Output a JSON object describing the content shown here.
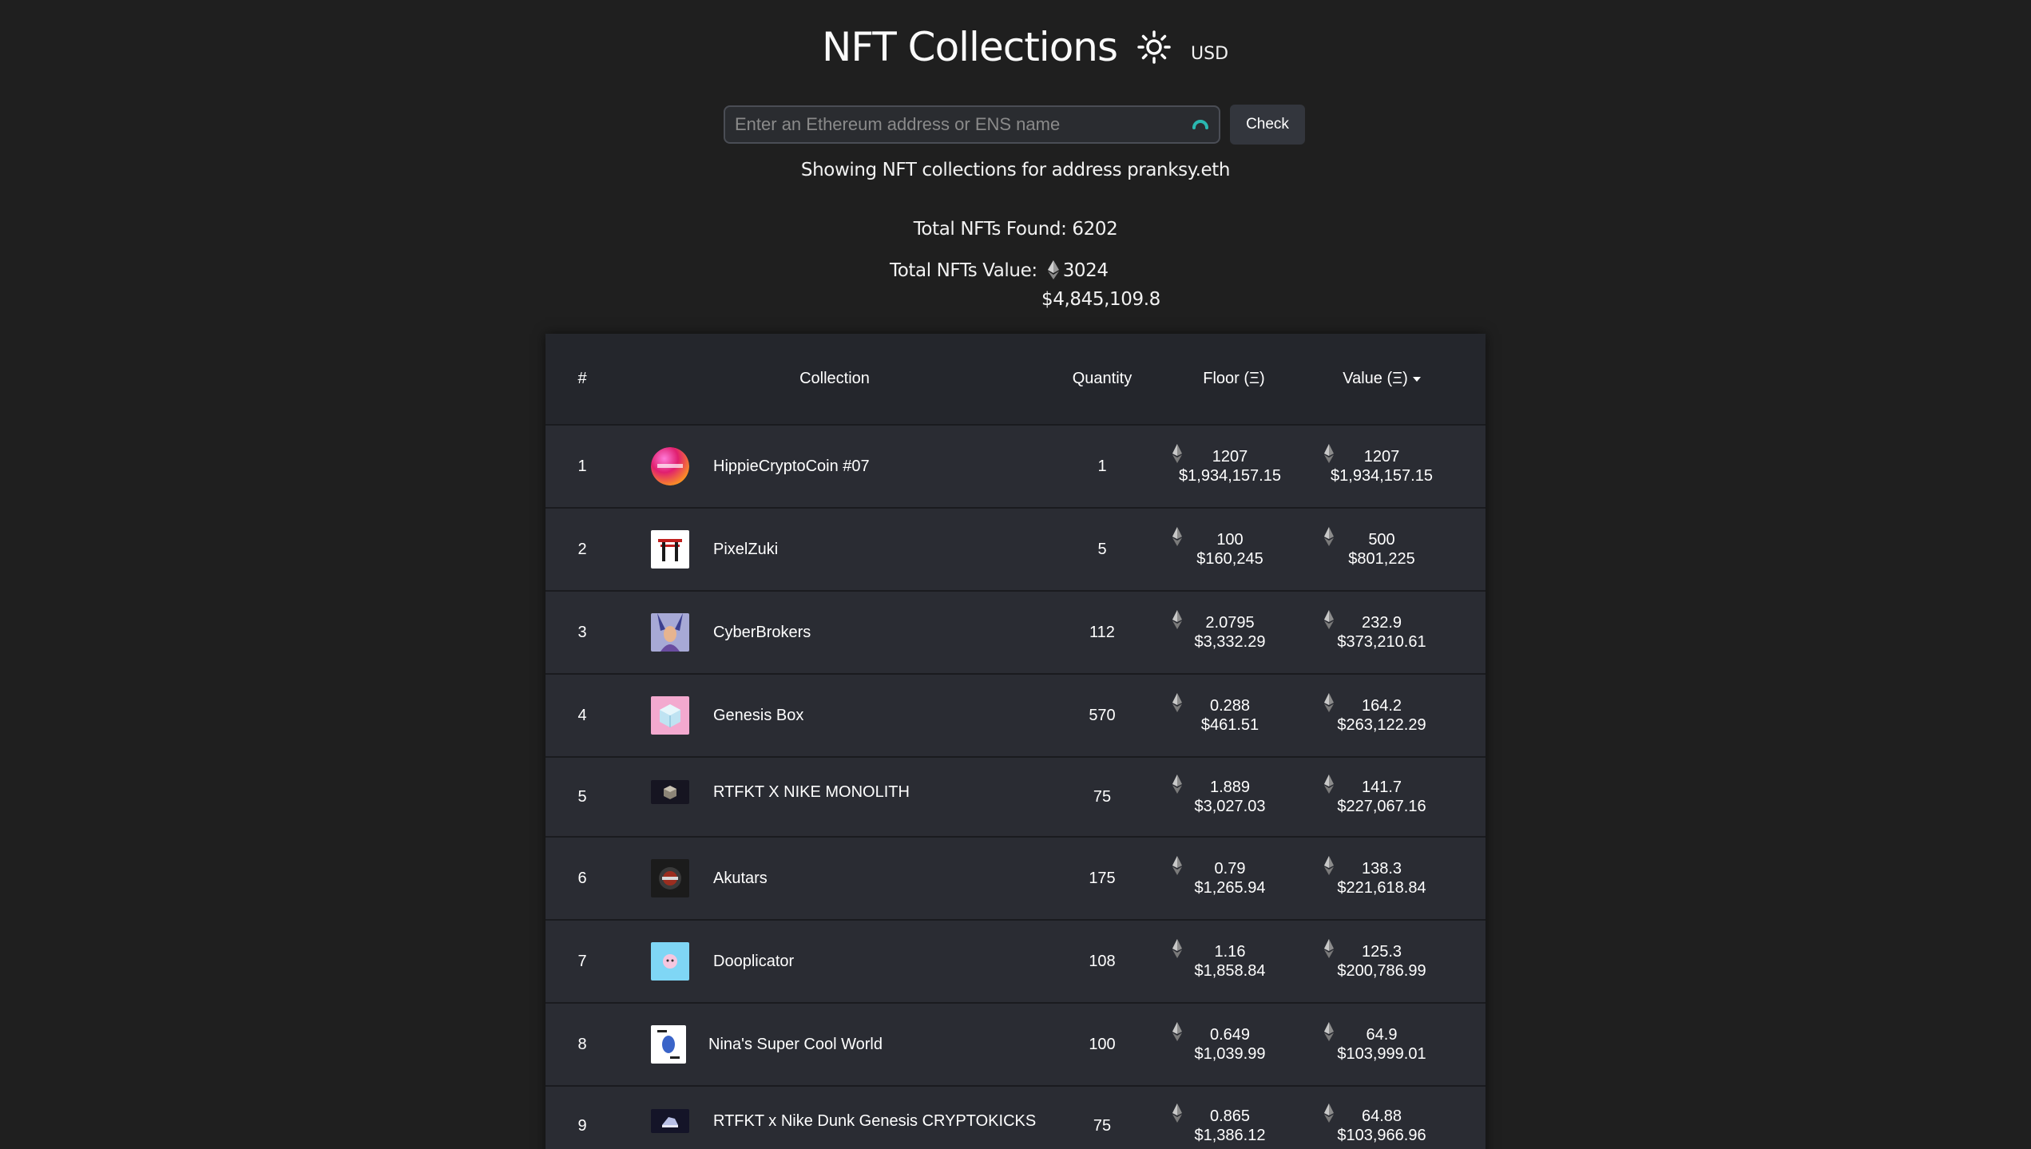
{
  "header": {
    "title": "NFT Collections",
    "theme_icon": "sun-icon",
    "currency": "USD"
  },
  "search": {
    "placeholder": "Enter an Ethereum address or ENS name",
    "value": "",
    "spinner_icon": "spinner-icon",
    "button_label": "Check",
    "spinner_color": "#2ab7b0"
  },
  "summary": {
    "showing": "Showing NFT collections for address pranksy.eth",
    "total_found": "Total NFTs Found: 6202",
    "total_value_label": "Total NFTs Value:",
    "total_value_eth": "3024",
    "total_value_usd": "$4,845,109.8"
  },
  "table": {
    "headers": {
      "num": "#",
      "collection": "Collection",
      "quantity": "Quantity",
      "floor": "Floor (Ξ)",
      "value": "Value (Ξ)"
    },
    "rows": [
      {
        "num": "1",
        "name": "HippieCryptoCoin #07",
        "qty": "1",
        "floor_eth": "1207",
        "floor_usd": "$1,934,157.15",
        "value_eth": "1207",
        "value_usd": "$1,934,157.15"
      },
      {
        "num": "2",
        "name": "PixelZuki",
        "qty": "5",
        "floor_eth": "100",
        "floor_usd": "$160,245",
        "value_eth": "500",
        "value_usd": "$801,225"
      },
      {
        "num": "3",
        "name": "CyberBrokers",
        "qty": "112",
        "floor_eth": "2.0795",
        "floor_usd": "$3,332.29",
        "value_eth": "232.9",
        "value_usd": "$373,210.61"
      },
      {
        "num": "4",
        "name": "Genesis Box",
        "qty": "570",
        "floor_eth": "0.288",
        "floor_usd": "$461.51",
        "value_eth": "164.2",
        "value_usd": "$263,122.29"
      },
      {
        "num": "5",
        "name": "RTFKT X NIKE MONOLITH",
        "qty": "75",
        "floor_eth": "1.889",
        "floor_usd": "$3,027.03",
        "value_eth": "141.7",
        "value_usd": "$227,067.16"
      },
      {
        "num": "6",
        "name": "Akutars",
        "qty": "175",
        "floor_eth": "0.79",
        "floor_usd": "$1,265.94",
        "value_eth": "138.3",
        "value_usd": "$221,618.84"
      },
      {
        "num": "7",
        "name": "Dooplicator",
        "qty": "108",
        "floor_eth": "1.16",
        "floor_usd": "$1,858.84",
        "value_eth": "125.3",
        "value_usd": "$200,786.99"
      },
      {
        "num": "8",
        "name": "Nina's Super Cool World",
        "qty": "100",
        "floor_eth": "0.649",
        "floor_usd": "$1,039.99",
        "value_eth": "64.9",
        "value_usd": "$103,999.01"
      },
      {
        "num": "9",
        "name": "RTFKT x Nike Dunk Genesis CRYPTOKICKS",
        "qty": "75",
        "floor_eth": "0.865",
        "floor_usd": "$1,386.12",
        "value_eth": "64.88",
        "value_usd": "$103,966.96"
      }
    ]
  }
}
